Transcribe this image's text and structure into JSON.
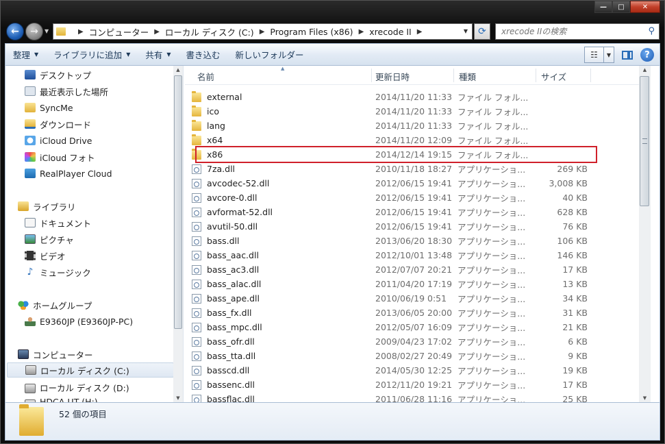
{
  "window": {
    "minimize_glyph": "—",
    "maximize_glyph": "□",
    "close_glyph": "✕"
  },
  "nav": {
    "back_glyph": "←",
    "forward_glyph": "→"
  },
  "address": {
    "segments": [
      "コンピューター",
      "ローカル ディスク (C:)",
      "Program Files (x86)",
      "xrecode II"
    ]
  },
  "search": {
    "placeholder": "xrecode IIの検索"
  },
  "commands": {
    "organize": "整理",
    "add_library": "ライブラリに追加",
    "share": "共有",
    "burn": "書き込む",
    "new_folder": "新しいフォルダー"
  },
  "sidebar": {
    "favorites": [
      {
        "label": "デスクトップ",
        "icon": "desktop-icon"
      },
      {
        "label": "最近表示した場所",
        "icon": "recent-places-icon"
      },
      {
        "label": "SyncMe",
        "icon": "folder-icon"
      },
      {
        "label": "ダウンロード",
        "icon": "downloads-icon"
      },
      {
        "label": "iCloud Drive",
        "icon": "icloud-drive-icon"
      },
      {
        "label": "iCloud フォト",
        "icon": "icloud-photos-icon"
      },
      {
        "label": "RealPlayer Cloud",
        "icon": "realplayer-icon"
      }
    ],
    "libraries": {
      "label": "ライブラリ",
      "items": [
        {
          "label": "ドキュメント",
          "icon": "documents-icon"
        },
        {
          "label": "ピクチャ",
          "icon": "pictures-icon"
        },
        {
          "label": "ビデオ",
          "icon": "videos-icon"
        },
        {
          "label": "ミュージック",
          "icon": "music-icon"
        }
      ]
    },
    "homegroup": {
      "label": "ホームグループ",
      "items": [
        {
          "label": "E9360JP (E9360JP-PC)",
          "icon": "user-icon"
        }
      ]
    },
    "computer": {
      "label": "コンピューター",
      "items": [
        {
          "label": "ローカル ディスク (C:)",
          "icon": "windows-drive-icon",
          "selected": true
        },
        {
          "label": "ローカル ディスク (D:)",
          "icon": "drive-icon"
        },
        {
          "label": "HDCA-UT (H:)",
          "icon": "drive-icon"
        }
      ]
    }
  },
  "columns": {
    "name": "名前",
    "date": "更新日時",
    "type": "種類",
    "size": "サイズ"
  },
  "files": [
    {
      "name": "external",
      "date": "2014/11/20 11:33",
      "type": "ファイル フォル...",
      "size": "",
      "kind": "folder"
    },
    {
      "name": "ico",
      "date": "2014/11/20 11:33",
      "type": "ファイル フォル...",
      "size": "",
      "kind": "folder"
    },
    {
      "name": "lang",
      "date": "2014/11/20 11:33",
      "type": "ファイル フォル...",
      "size": "",
      "kind": "folder"
    },
    {
      "name": "x64",
      "date": "2014/11/20 12:09",
      "type": "ファイル フォル...",
      "size": "",
      "kind": "folder"
    },
    {
      "name": "x86",
      "date": "2014/12/14 19:15",
      "type": "ファイル フォル...",
      "size": "",
      "kind": "folder",
      "highlighted": true
    },
    {
      "name": "7za.dll",
      "date": "2010/11/18 18:27",
      "type": "アプリケーショ...",
      "size": "269 KB",
      "kind": "dll"
    },
    {
      "name": "avcodec-52.dll",
      "date": "2012/06/15 19:41",
      "type": "アプリケーショ...",
      "size": "3,008 KB",
      "kind": "dll"
    },
    {
      "name": "avcore-0.dll",
      "date": "2012/06/15 19:41",
      "type": "アプリケーショ...",
      "size": "40 KB",
      "kind": "dll"
    },
    {
      "name": "avformat-52.dll",
      "date": "2012/06/15 19:41",
      "type": "アプリケーショ...",
      "size": "628 KB",
      "kind": "dll"
    },
    {
      "name": "avutil-50.dll",
      "date": "2012/06/15 19:41",
      "type": "アプリケーショ...",
      "size": "76 KB",
      "kind": "dll"
    },
    {
      "name": "bass.dll",
      "date": "2013/06/20 18:30",
      "type": "アプリケーショ...",
      "size": "106 KB",
      "kind": "dll"
    },
    {
      "name": "bass_aac.dll",
      "date": "2012/10/01 13:48",
      "type": "アプリケーショ...",
      "size": "146 KB",
      "kind": "dll"
    },
    {
      "name": "bass_ac3.dll",
      "date": "2012/07/07 20:21",
      "type": "アプリケーショ...",
      "size": "17 KB",
      "kind": "dll"
    },
    {
      "name": "bass_alac.dll",
      "date": "2011/04/20 17:19",
      "type": "アプリケーショ...",
      "size": "13 KB",
      "kind": "dll"
    },
    {
      "name": "bass_ape.dll",
      "date": "2010/06/19 0:51",
      "type": "アプリケーショ...",
      "size": "34 KB",
      "kind": "dll"
    },
    {
      "name": "bass_fx.dll",
      "date": "2013/06/05 20:00",
      "type": "アプリケーショ...",
      "size": "31 KB",
      "kind": "dll"
    },
    {
      "name": "bass_mpc.dll",
      "date": "2012/05/07 16:09",
      "type": "アプリケーショ...",
      "size": "21 KB",
      "kind": "dll"
    },
    {
      "name": "bass_ofr.dll",
      "date": "2009/04/23 17:02",
      "type": "アプリケーショ...",
      "size": "6 KB",
      "kind": "dll"
    },
    {
      "name": "bass_tta.dll",
      "date": "2008/02/27 20:49",
      "type": "アプリケーショ...",
      "size": "9 KB",
      "kind": "dll"
    },
    {
      "name": "basscd.dll",
      "date": "2014/05/30 12:25",
      "type": "アプリケーショ...",
      "size": "19 KB",
      "kind": "dll"
    },
    {
      "name": "bassenc.dll",
      "date": "2012/11/20 19:21",
      "type": "アプリケーショ...",
      "size": "17 KB",
      "kind": "dll"
    },
    {
      "name": "bassflac.dll",
      "date": "2011/06/28 11:16",
      "type": "アプリケーショ...",
      "size": "25 KB",
      "kind": "dll"
    }
  ],
  "status": {
    "item_count": "52 個の項目"
  }
}
